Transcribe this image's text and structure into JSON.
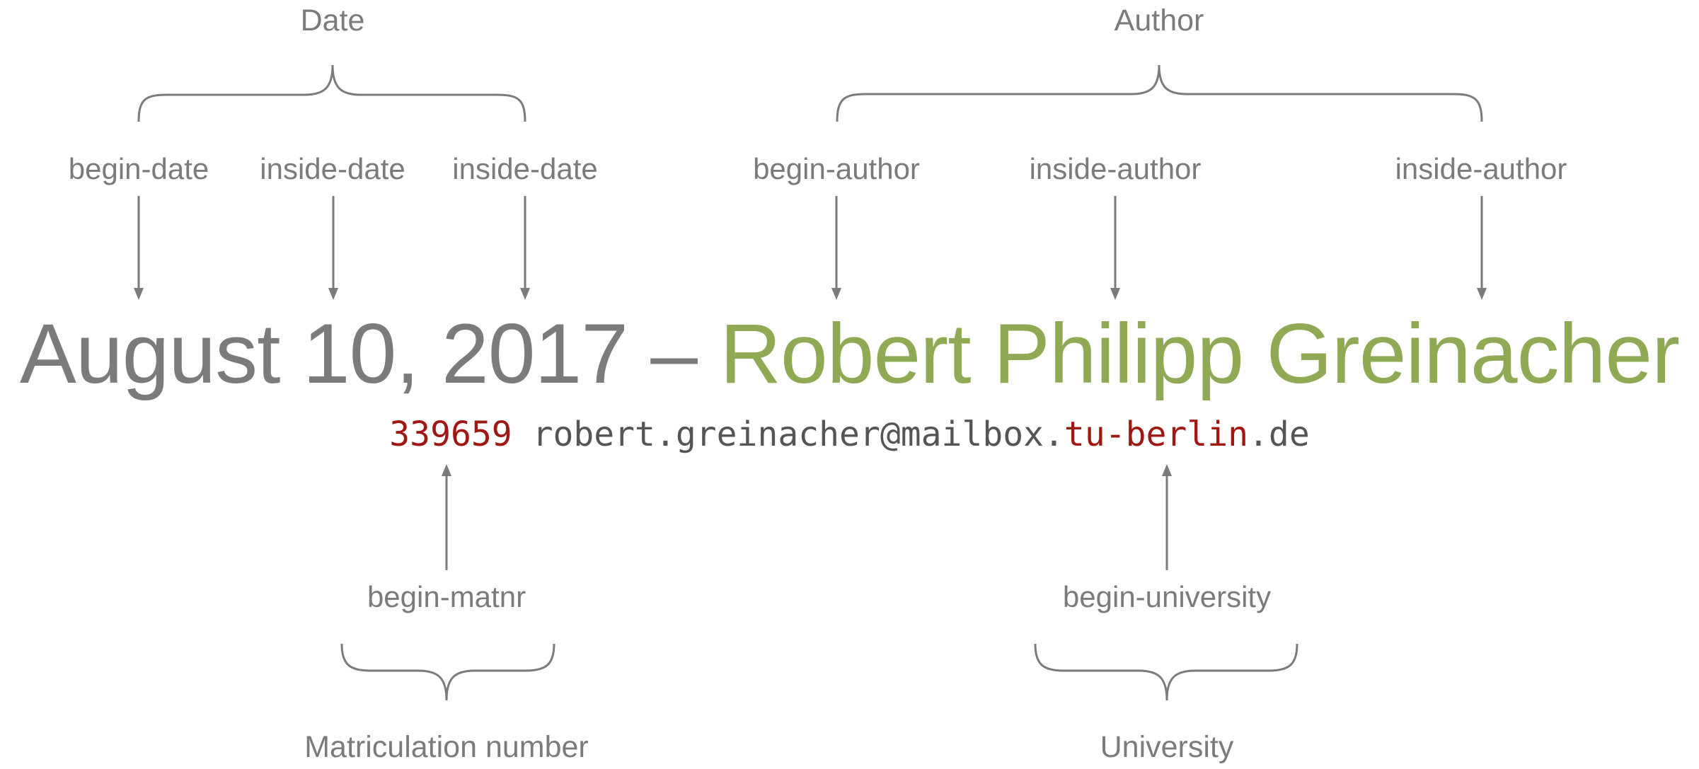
{
  "groups": {
    "date": "Date",
    "author": "Author",
    "matnr": "Matriculation number",
    "university": "University"
  },
  "tags": {
    "begin_date": "begin-date",
    "inside_date_1": "inside-date",
    "inside_date_2": "inside-date",
    "begin_author": "begin-author",
    "inside_author_1": "inside-author",
    "inside_author_2": "inside-author",
    "begin_matnr": "begin-matnr",
    "begin_university": "begin-university"
  },
  "main": {
    "date": "August 10, 2017",
    "dash": " – ",
    "author": "Robert Philipp Greinacher"
  },
  "sub": {
    "matnr": "339659",
    "space": " ",
    "email_start": "robert.greinacher@mailbox.",
    "email_uni": "tu-berlin",
    "email_end": ".de"
  },
  "colors": {
    "grey": "#7b7b7b",
    "green": "#8fa955",
    "red": "#a01812",
    "dark": "#555555"
  }
}
